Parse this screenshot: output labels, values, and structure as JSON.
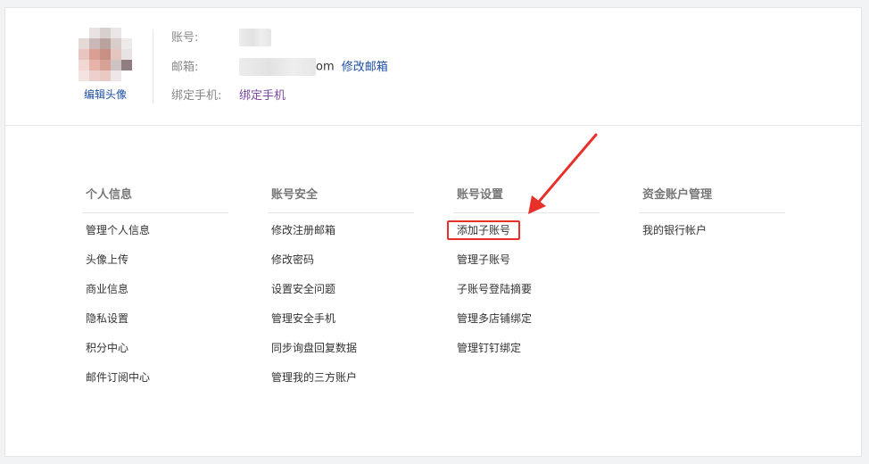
{
  "profile": {
    "edit_avatar": "编辑头像",
    "account_label": "账号:",
    "email_label": "邮箱:",
    "email_suffix": "om",
    "edit_email": "修改邮箱",
    "phone_label": "绑定手机:",
    "bind_phone": "绑定手机"
  },
  "columns": [
    {
      "title": "个人信息",
      "items": [
        "管理个人信息",
        "头像上传",
        "商业信息",
        "隐私设置",
        "积分中心",
        "邮件订阅中心"
      ]
    },
    {
      "title": "账号安全",
      "items": [
        "修改注册邮箱",
        "修改密码",
        "设置安全问题",
        "管理安全手机",
        "同步询盘回复数据",
        "管理我的三方账户"
      ]
    },
    {
      "title": "账号设置",
      "items": [
        "添加子账号",
        "管理子账号",
        "子账号登陆摘要",
        "管理多店铺绑定",
        "管理钉钉绑定"
      ]
    },
    {
      "title": "资金账户管理",
      "items": [
        "我的银行帐户"
      ]
    }
  ],
  "colors": {
    "link_blue": "#1d4fa3",
    "link_purple": "#7a4aa0",
    "highlight_red": "#e8302a"
  }
}
